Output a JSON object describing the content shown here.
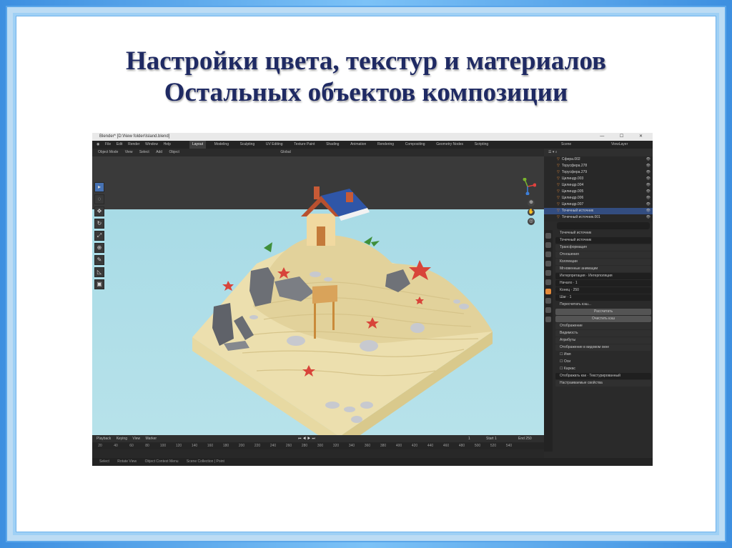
{
  "slide": {
    "title_line1": "Настройки цвета, текстур и материалов",
    "title_line2": "Остальных объектов композиции"
  },
  "blender": {
    "window_title": "Blender* [D:\\New folder\\Island.blend]",
    "window_controls": "— ☐ ✕",
    "menu": [
      "File",
      "Edit",
      "Render",
      "Window",
      "Help"
    ],
    "workspaces": [
      "Layout",
      "Modeling",
      "Sculpting",
      "UV Editing",
      "Texture Paint",
      "Shading",
      "Animation",
      "Rendering",
      "Compositing",
      "Geometry Nodes",
      "Scripting"
    ],
    "active_workspace": "Layout",
    "scene_label": "Scene",
    "view_layer_label": "ViewLayer",
    "viewport_header": [
      "Object Mode",
      "View",
      "Select",
      "Add",
      "Object",
      "Global"
    ],
    "tools": [
      "▸",
      "◌",
      "✥",
      "↻",
      "⤢",
      "⊕",
      "✎",
      "◺",
      "▣"
    ],
    "timeline_header": [
      "Playback",
      "Keying",
      "View",
      "Marker"
    ],
    "timeline_frame": "1",
    "timeline_start": "Start 1",
    "timeline_end": "End 250",
    "ruler_ticks": [
      "20",
      "40",
      "60",
      "80",
      "100",
      "120",
      "140",
      "160",
      "180",
      "200",
      "220",
      "240",
      "260",
      "280",
      "300",
      "320",
      "340",
      "360",
      "380",
      "400",
      "420",
      "440",
      "460",
      "480",
      "500",
      "520",
      "540"
    ],
    "status_items": [
      "Select",
      "Rotate View",
      "Object Context Menu",
      "Scene Collection | Point"
    ],
    "outliner": {
      "rows": [
        {
          "name": "Сфера.002",
          "selected": false
        },
        {
          "name": "Торусфера.278",
          "selected": false
        },
        {
          "name": "Торусфера.279",
          "selected": false
        },
        {
          "name": "Цилиндр.003",
          "selected": false
        },
        {
          "name": "Цилиндр.004",
          "selected": false
        },
        {
          "name": "Цилиндр.005",
          "selected": false
        },
        {
          "name": "Цилиндр.006",
          "selected": false
        },
        {
          "name": "Цилиндр.007",
          "selected": false
        },
        {
          "name": "Точечный источник",
          "selected": true
        },
        {
          "name": "Точечный источник.001",
          "selected": false
        }
      ]
    },
    "properties": {
      "search_placeholder": "",
      "object_name": "Точечный источник",
      "data_name": "Точечный источник",
      "sections": [
        "Трансформация",
        "Отношения",
        "Коллекции",
        "Мгновенные анимации"
      ],
      "fields": [
        {
          "label": "Интерпретация",
          "value": "Интерполяция"
        },
        {
          "label": "Начало",
          "value": "1"
        },
        {
          "label": "Конец",
          "value": "250"
        },
        {
          "label": "Шаг",
          "value": "1"
        }
      ],
      "notice": "Пересчитать кэш...",
      "btn1": "Рассчитать",
      "btn2": "Очистить кэш",
      "sections2": [
        "Отображение",
        "Видимость",
        "Атрибуты",
        "Отображение в видовом окне"
      ],
      "options": [
        "Имя",
        "Оси",
        "Каркас"
      ],
      "display_as": "Отображать как",
      "display_value": "Текстурированный",
      "custom_props": "Настраиваемые свойства"
    }
  }
}
